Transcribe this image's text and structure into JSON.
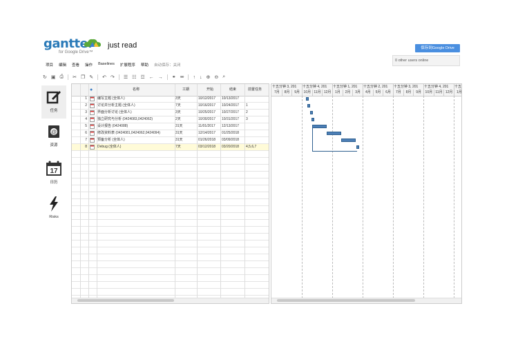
{
  "app": {
    "logo": "gantter",
    "logo_sub": "for Google Drive™",
    "document_title": "just read",
    "save_button": "保存到Google Drive",
    "online_users": "0 other users online"
  },
  "menu": {
    "items": [
      "项目",
      "编辑",
      "查看",
      "操作",
      "Baselines",
      "扩展程序",
      "帮助"
    ],
    "autosave": "自动保存：关闭"
  },
  "nav": [
    {
      "label": "任务",
      "icon": "tasks-icon"
    },
    {
      "label": "资源",
      "icon": "resources-icon"
    },
    {
      "label": "日历",
      "icon": "calendar-icon",
      "day": "17"
    },
    {
      "label": "Risks",
      "icon": "risks-icon"
    }
  ],
  "grid": {
    "columns": [
      "名称",
      "工期",
      "开始",
      "结束",
      "前置任务"
    ],
    "rows": [
      {
        "num": "1",
        "name": "编写主题 (全体人)",
        "duration": "3天",
        "start": "10/12/2017",
        "end": "10/13/2017",
        "pred": ""
      },
      {
        "num": "2",
        "name": "讨论并分析主题 (全体人)",
        "duration": "7天",
        "start": "10/16/2017",
        "end": "10/24/2017",
        "pred": "1"
      },
      {
        "num": "3",
        "name": "界面分析讨论 (全体人)",
        "duration": "3天",
        "start": "10/25/2017",
        "end": "10/27/2017",
        "pred": "2"
      },
      {
        "num": "4",
        "name": "独立研究与分析 (0424083,0424062)",
        "duration": "2天",
        "start": "10/30/2017",
        "end": "10/31/2017",
        "pred": "3"
      },
      {
        "num": "5",
        "name": "设计报告 (0424088)",
        "duration": "31天",
        "start": "11/01/2017",
        "end": "12/13/2017",
        "pred": ""
      },
      {
        "num": "6",
        "name": "修改资料表 (0424081,0424062,0424094)",
        "duration": "31天",
        "start": "12/14/2017",
        "end": "01/25/2018",
        "pred": ""
      },
      {
        "num": "7",
        "name": "预备分析 (全体人)",
        "duration": "31天",
        "start": "01/26/2018",
        "end": "03/09/2018",
        "pred": ""
      },
      {
        "num": "8",
        "name": "Debug (全体人)",
        "duration": "7天",
        "start": "03/12/2018",
        "end": "03/20/2018",
        "pred": "4,5,6,7"
      }
    ]
  },
  "gantt": {
    "quarters": [
      "十五分钟 3, 201",
      "十五分钟 4, 201",
      "十五分钟 1, 201",
      "十五分钟 2, 201",
      "十五分钟 3, 201",
      "十五分钟 4, 201",
      "十五"
    ],
    "months": [
      "7月",
      "8月",
      "9月",
      "10月",
      "11月",
      "12月",
      "1月",
      "2月",
      "3月",
      "4月",
      "5月",
      "6月",
      "7月",
      "8月",
      "9月",
      "10月",
      "11月",
      "12月",
      "1月"
    ]
  }
}
